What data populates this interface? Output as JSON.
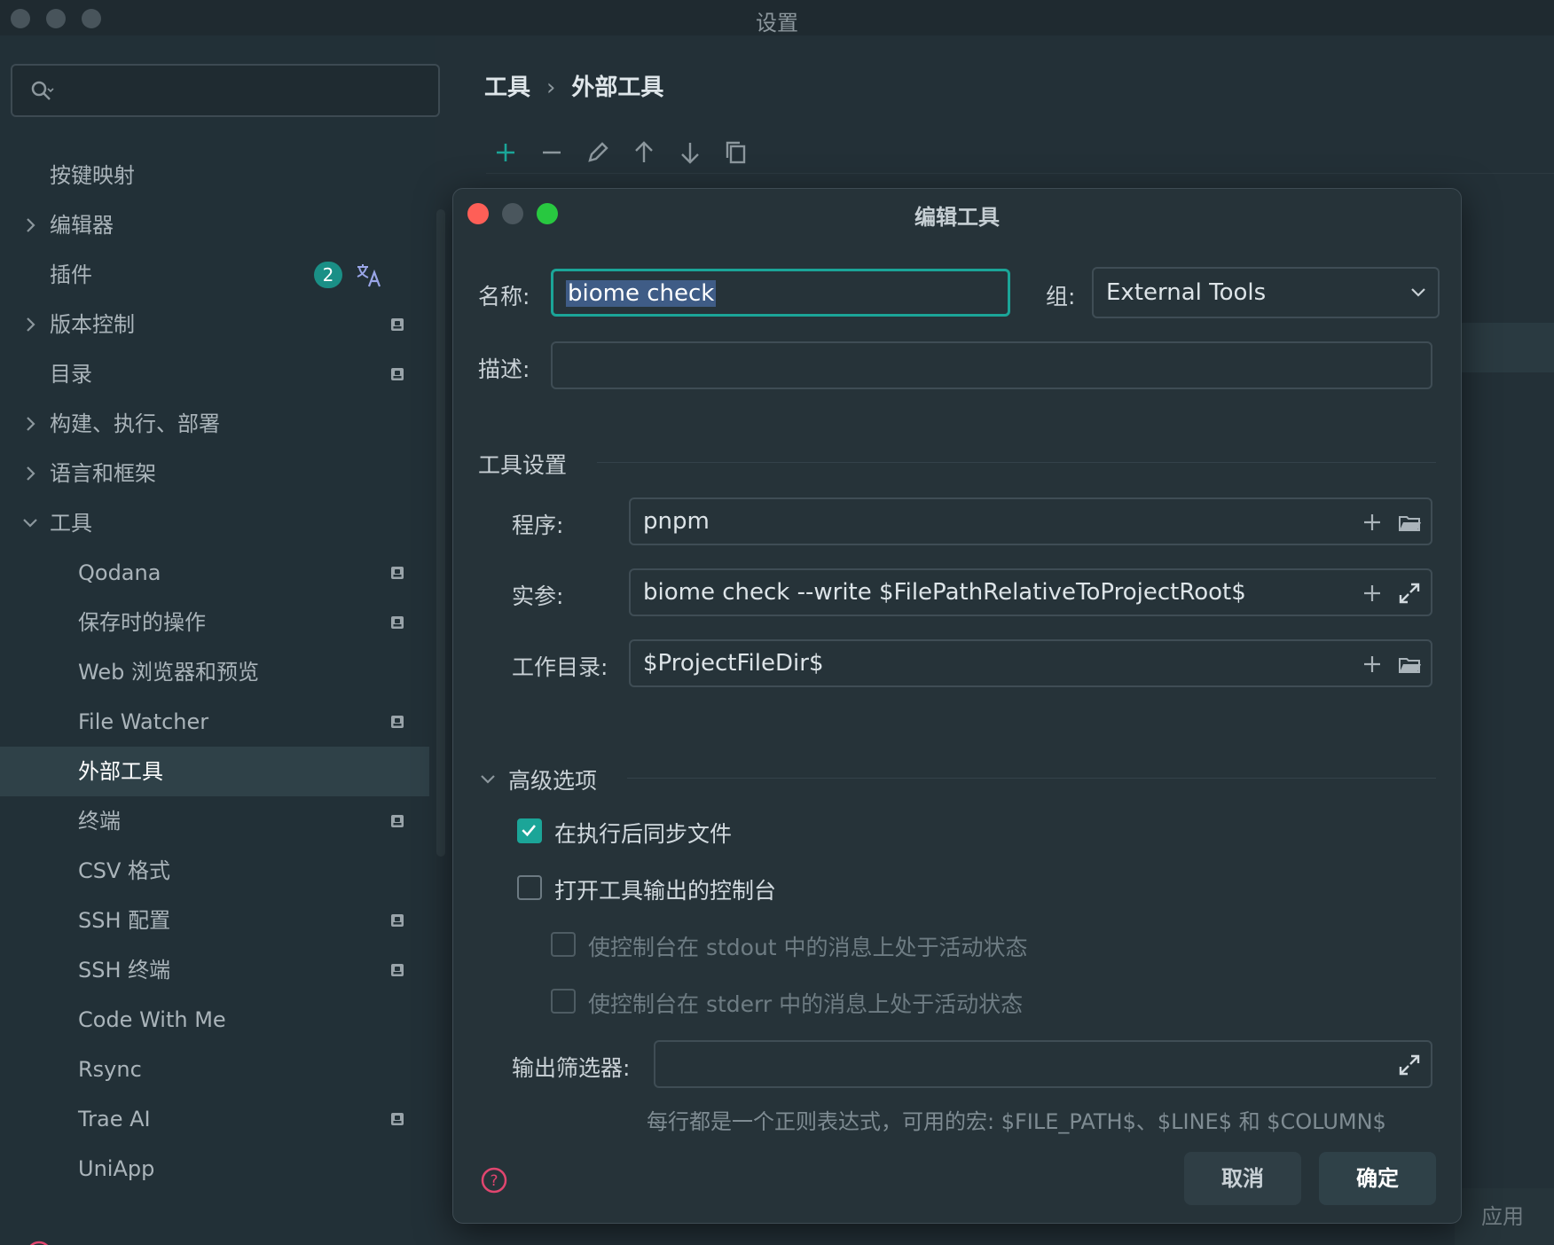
{
  "window": {
    "title": "设置"
  },
  "sidebar": {
    "search_placeholder": "",
    "items": [
      {
        "label": "按键映射",
        "expand": "none",
        "indent": 0,
        "managed": false
      },
      {
        "label": "编辑器",
        "expand": "collapsed",
        "indent": 0,
        "managed": false
      },
      {
        "label": "插件",
        "expand": "none",
        "indent": 0,
        "managed": false,
        "count": "2"
      },
      {
        "label": "版本控制",
        "expand": "collapsed",
        "indent": 0,
        "managed": true
      },
      {
        "label": "目录",
        "expand": "none",
        "indent": 0,
        "managed": true
      },
      {
        "label": "构建、执行、部署",
        "expand": "collapsed",
        "indent": 0,
        "managed": false
      },
      {
        "label": "语言和框架",
        "expand": "collapsed",
        "indent": 0,
        "managed": false
      },
      {
        "label": "工具",
        "expand": "expanded",
        "indent": 0,
        "managed": false
      },
      {
        "label": "Qodana",
        "expand": "none",
        "indent": 1,
        "managed": true
      },
      {
        "label": "保存时的操作",
        "expand": "none",
        "indent": 1,
        "managed": true
      },
      {
        "label": "Web 浏览器和预览",
        "expand": "none",
        "indent": 1,
        "managed": false
      },
      {
        "label": "File Watcher",
        "expand": "none",
        "indent": 1,
        "managed": true
      },
      {
        "label": "外部工具",
        "expand": "none",
        "indent": 1,
        "managed": false,
        "selected": true
      },
      {
        "label": "终端",
        "expand": "none",
        "indent": 1,
        "managed": true
      },
      {
        "label": "CSV 格式",
        "expand": "none",
        "indent": 1,
        "managed": false
      },
      {
        "label": "SSH 配置",
        "expand": "none",
        "indent": 1,
        "managed": true
      },
      {
        "label": "SSH 终端",
        "expand": "none",
        "indent": 1,
        "managed": true
      },
      {
        "label": "Code With Me",
        "expand": "none",
        "indent": 1,
        "managed": false
      },
      {
        "label": "Rsync",
        "expand": "none",
        "indent": 1,
        "managed": false
      },
      {
        "label": "Trae AI",
        "expand": "none",
        "indent": 1,
        "managed": true
      },
      {
        "label": "UniApp",
        "expand": "none",
        "indent": 1,
        "managed": false
      }
    ]
  },
  "breadcrumb": {
    "parent": "工具",
    "sep": "›",
    "current": "外部工具"
  },
  "toolbar_icons": [
    "add-icon",
    "remove-icon",
    "edit-icon",
    "move-up-icon",
    "move-down-icon",
    "copy-icon"
  ],
  "footer": {
    "apply_label": "应用(A)"
  },
  "dialog": {
    "title": "编辑工具",
    "name_label": "名称:",
    "name_value": "biome check",
    "group_label": "组:",
    "group_value": "External Tools",
    "desc_label": "描述:",
    "desc_value": "",
    "tool_settings_title": "工具设置",
    "program_label": "程序:",
    "program_value": "pnpm",
    "args_label": "实参:",
    "args_value": "biome check --write $FilePathRelativeToProjectRoot$",
    "workdir_label": "工作目录:",
    "workdir_value": "$ProjectFileDir$",
    "advanced_title": "高级选项",
    "sync_files_label": "在执行后同步文件",
    "open_console_label": "打开工具输出的控制台",
    "stdout_label": "使控制台在 stdout 中的消息上处于活动状态",
    "stderr_label": "使控制台在 stderr 中的消息上处于活动状态",
    "output_filter_label": "输出筛选器:",
    "output_filter_value": "",
    "hint": "每行都是一个正则表达式，可用的宏: $FILE_PATH$、$LINE$ 和 $COLUMN$",
    "cancel_label": "取消",
    "ok_label": "确定",
    "checks": {
      "sync_files": true,
      "open_console": false,
      "stdout": false,
      "stderr": false
    }
  },
  "colors": {
    "accent": "#1ba598",
    "selection": "#3f5c86",
    "close": "#fe5f57",
    "zoom": "#28c840"
  }
}
